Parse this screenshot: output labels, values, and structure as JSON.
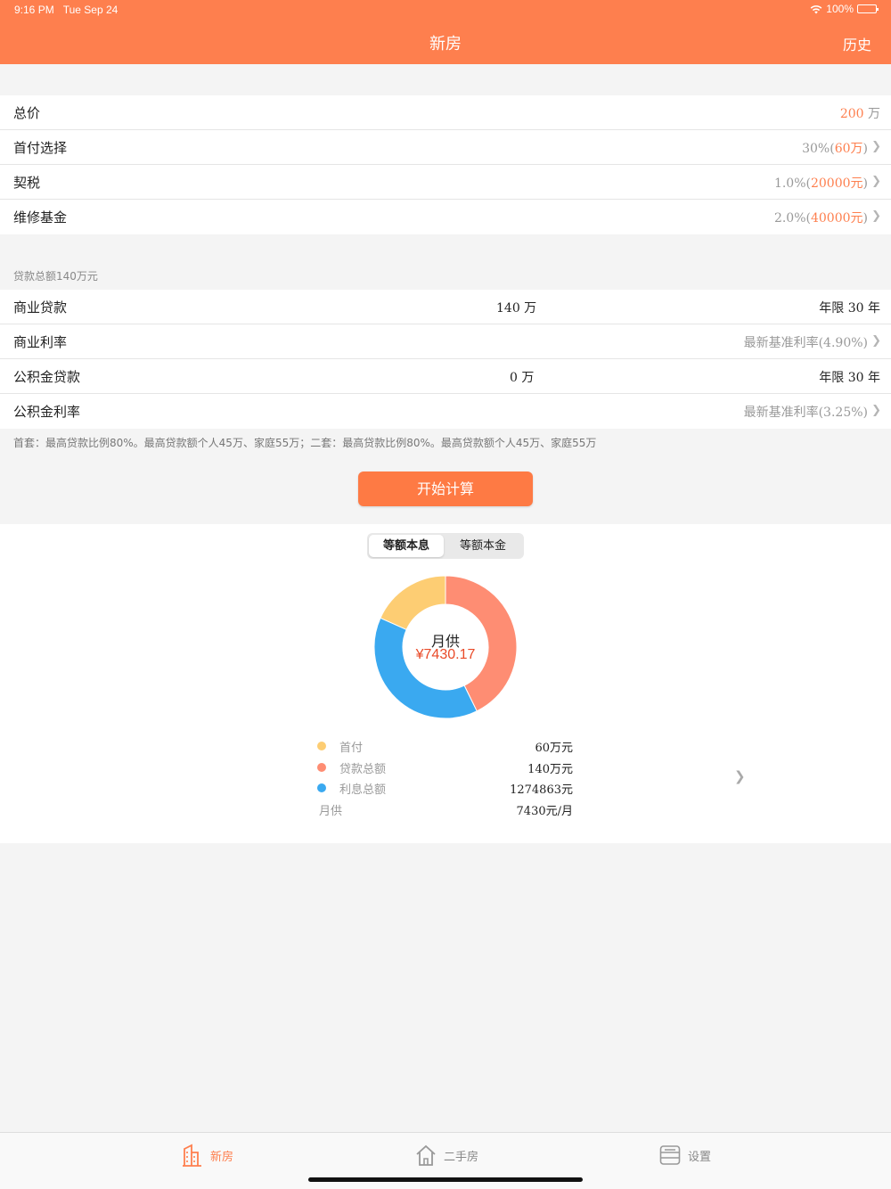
{
  "status": {
    "time": "9:16 PM",
    "date": "Tue Sep 24",
    "battery": "100%"
  },
  "nav": {
    "title": "新房",
    "history_label": "历史"
  },
  "basic": {
    "total_price": {
      "label": "总价",
      "value": "200",
      "unit": " 万"
    },
    "down_payment": {
      "label": "首付选择",
      "pct": "30%(",
      "amount": "60万",
      "close": ")"
    },
    "deed_tax": {
      "label": "契税",
      "pct": "1.0%(",
      "amount": "20000元",
      "close": ")"
    },
    "maintenance": {
      "label": "维修基金",
      "pct": "2.0%(",
      "amount": "40000元",
      "close": ")"
    }
  },
  "loan_header": "贷款总额140万元",
  "loans": {
    "commercial": {
      "label": "商业贷款",
      "amount": "140 万",
      "term": "年限 30 年"
    },
    "commercial_rate": {
      "label": "商业利率",
      "value": "最新基准利率(4.90%)"
    },
    "fund": {
      "label": "公积金贷款",
      "amount": "0 万",
      "term": "年限 30 年"
    },
    "fund_rate": {
      "label": "公积金利率",
      "value": "最新基准利率(3.25%)"
    }
  },
  "note": "首套：最高贷款比例80%。最高贷款额个人45万、家庭55万；二套：最高贷款比例80%。最高贷款额个人45万、家庭55万",
  "calc_button": "开始计算",
  "result": {
    "tabs": [
      "等额本息",
      "等额本金"
    ],
    "center_label": "月供",
    "center_amount": "¥7430.17",
    "legend": [
      {
        "name": "首付",
        "value": "60万元",
        "color": "#fdcd73"
      },
      {
        "name": "贷款总额",
        "value": "140万元",
        "color": "#fe8d73"
      },
      {
        "name": "利息总额",
        "value": "1274863元",
        "color": "#3aa9f0"
      }
    ],
    "monthly": {
      "name": "月供",
      "value": "7430元/月"
    }
  },
  "chart_data": {
    "type": "pie",
    "categories": [
      "首付",
      "贷款总额",
      "利息总额"
    ],
    "values": [
      600000,
      1400000,
      1274863
    ],
    "colors": [
      "#fdcd73",
      "#fe8d73",
      "#3aa9f0"
    ]
  },
  "tabbar": {
    "new_house": "新房",
    "second_hand": "二手房",
    "settings": "设置"
  },
  "colors": {
    "accent": "#fe7f4e"
  }
}
